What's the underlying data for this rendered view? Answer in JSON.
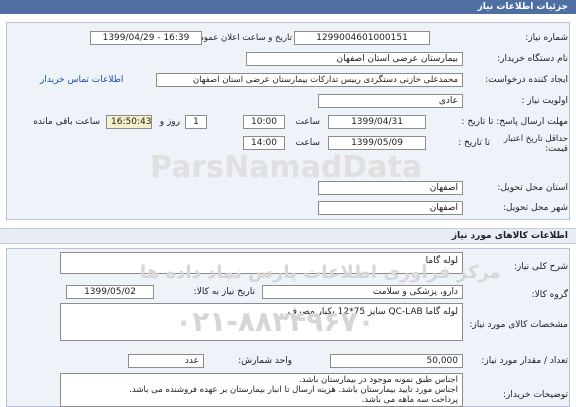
{
  "header": {
    "title": "جزئیات اطلاعات نیاز"
  },
  "need": {
    "number_label": "شماره نیاز:",
    "number": "1299004601000151",
    "announce_label": "تاریخ و ساعت اعلان عمومی:",
    "announce": "1399/04/29 - 16:39",
    "buyer_label": "نام دستگاه خریدار:",
    "buyer": "بیمارستان عرضی استان اصفهان",
    "creator_label": "ایجاد کننده درخواست:",
    "creator": "محمدعلی خازنی دستگردی رییس تدارکات بیمارستان عرضی استان اصفهان",
    "contact_link": "اطلاعات تماس خریدار",
    "priority_label": "اولویت نیاز :",
    "priority": "عادی",
    "send_label": "مهلت ارسال پاسخ: تا تاریخ :",
    "send_date": "1399/04/31",
    "time_label": "ساعت",
    "send_time": "10:00",
    "days": "1",
    "days_label": "روز و",
    "remaining_time": "16:50:43",
    "remaining_label": "ساعت باقی مانده",
    "validity_label": "حداقل تاریخ اعتبار قیمت:",
    "validity_until": "تا تاریخ :",
    "validity_date": "1399/05/09",
    "validity_time": "14:00",
    "province_label": "استان محل تحویل:",
    "province": "اصفهان",
    "city_label": "شهر محل تحویل:",
    "city": "اصفهان"
  },
  "goods": {
    "title": "اطلاعات کالاهای مورد نیاز",
    "summary_label": "شرح کلی نیاز:",
    "summary": "لوله گاما",
    "group_label": "گروه کالا:",
    "group": "دارو، پزشکی و سلامت",
    "need_date_label": "تاریخ نیاز به کالا:",
    "need_date": "1399/05/02",
    "spec_label": "مشخصات کالای مورد نیاز:",
    "spec": "لوله گاما QC-LAB سایز 75*12 یکبار مصرف",
    "unit_label": "واحد شمارش:",
    "unit": "عدد",
    "qty_label": "تعداد / مقدار مورد نیاز:",
    "qty": "50,000",
    "notes_label": "توضیحات خریدار:",
    "notes": [
      "اجناس طبق نمونه موجود در بیمارستان باشد.",
      "اجناس مورد تایید بیمارستان باشد. هزینه ارسال تا انبار بیمارستان بر عهده فروشنده می باشد.",
      "پرداخت سه ماهه می باشد."
    ]
  },
  "watermark": {
    "brand": "ParsNamadData",
    "slogan": "مرکز فراوری اطلاعات پارس نماد داده ها",
    "phone": "۰۲۱-۸۸۳۴۹۶۷۰"
  }
}
